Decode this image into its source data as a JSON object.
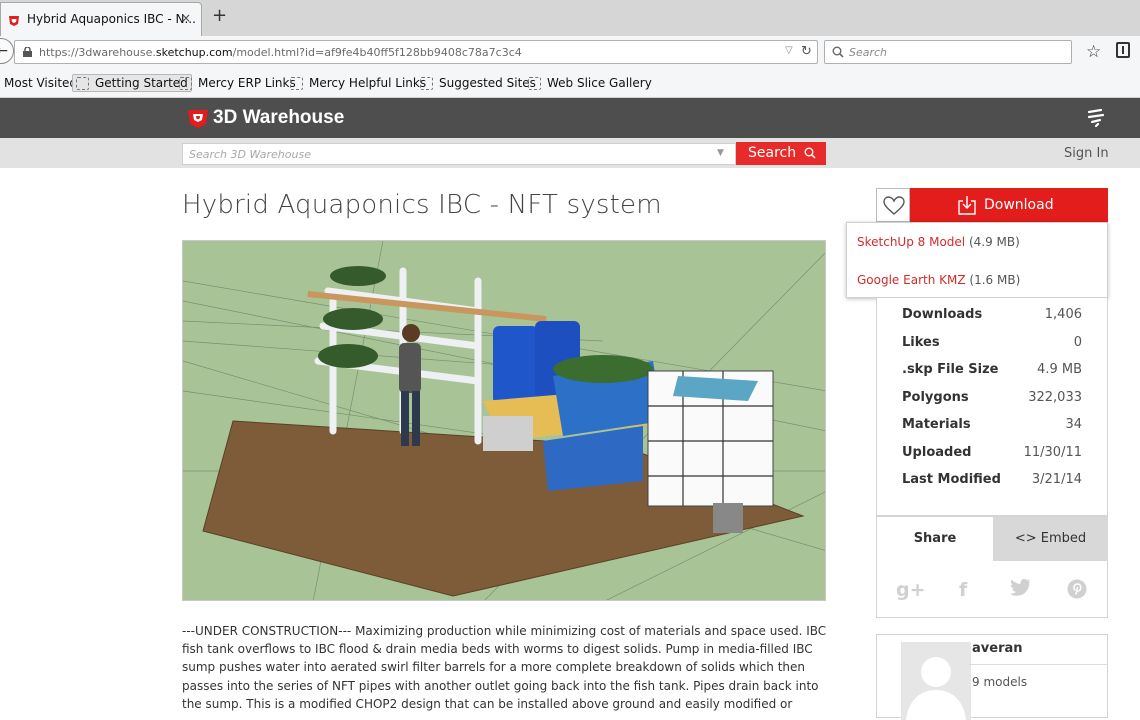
{
  "browser": {
    "tab_title": "Hybrid Aquaponics IBC - N...",
    "tab_close": "×",
    "new_tab": "+",
    "url_prefix": "https://3dwarehouse.",
    "url_domain": "sketchup.com",
    "url_suffix": "/model.html?id=af9fe4b40ff5f128bb9408c78a7c3c4",
    "search_placeholder": "Search",
    "bookmarks": [
      {
        "label": "Most Visited"
      },
      {
        "label": "Getting Started"
      },
      {
        "label": "Mercy ERP Links"
      },
      {
        "label": "Mercy Helpful Links"
      },
      {
        "label": "Suggested Sites"
      },
      {
        "label": "Web Slice Gallery"
      }
    ]
  },
  "site": {
    "logo": "3D Warehouse",
    "search_placeholder": "Search 3D Warehouse",
    "search_button": "Search",
    "sign_in": "Sign In",
    "accent": "#e31c1c"
  },
  "model": {
    "title": "Hybrid Aquaponics IBC - NFT system",
    "description": "---UNDER CONSTRUCTION--- Maximizing production while minimizing cost of materials and space used. IBC fish tank overflows to IBC flood & drain media beds with worms to digest solids. Pump in media-filled IBC sump pushes water into aerated swirl filter barrels for a more complete breakdown of solids which then passes into the series of NFT pipes with another outlet going back into the fish tank. Pipes drain back into the sump. This is a modified CHOP2 design that can be installed above ground and easily modified or"
  },
  "download": {
    "button": "Download",
    "options": [
      {
        "label": "SketchUp 8 Model",
        "size": "(4.9 MB)"
      },
      {
        "label": "Google Earth KMZ",
        "size": "(1.6 MB)"
      }
    ]
  },
  "stats": [
    {
      "label": "Downloads",
      "value": "1,406"
    },
    {
      "label": "Likes",
      "value": "0"
    },
    {
      "label": ".skp File Size",
      "value": "4.9 MB"
    },
    {
      "label": "Polygons",
      "value": "322,033"
    },
    {
      "label": "Materials",
      "value": "34"
    },
    {
      "label": "Uploaded",
      "value": "11/30/11"
    },
    {
      "label": "Last Modified",
      "value": "3/21/14"
    }
  ],
  "share": {
    "share_tab": "Share",
    "embed_tab": "<> Embed",
    "social": [
      "g+",
      "f",
      "twitter",
      "pinterest"
    ]
  },
  "author": {
    "name": "averan",
    "models": "9 models"
  }
}
